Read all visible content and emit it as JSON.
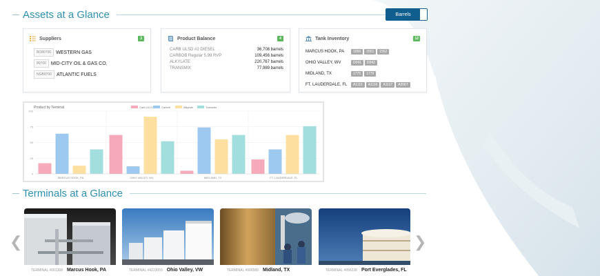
{
  "assets_section": {
    "title": "Assets at a Glance",
    "unit_toggle": "Barrels"
  },
  "suppliers": {
    "title": "Suppliers",
    "count": "3",
    "items": [
      {
        "code": "BO80700",
        "name": "WESTERN GAS"
      },
      {
        "code": "80700",
        "name": "MID-CITY OIL & GAS CO."
      },
      {
        "code": "NGB0700",
        "name": "ATLANTIC FUELS"
      }
    ]
  },
  "product_balance": {
    "title": "Product Balance",
    "count": "4",
    "items": [
      {
        "name": "CARB ULSD #2 DIESEL",
        "value": "36,708 barrels"
      },
      {
        "name": "CARBOB Regular 5.99 RVP",
        "value": "109,456 barrels"
      },
      {
        "name": "ALKYLATE",
        "value": "220,767 barrels"
      },
      {
        "name": "TRANSMIX",
        "value": "77,989 barrels"
      }
    ]
  },
  "tank_inventory": {
    "title": "Tank Inventory",
    "count": "12",
    "items": [
      {
        "location": "MARCUS HOOK, PA",
        "tanks": [
          "1056",
          "1551",
          "1552"
        ]
      },
      {
        "location": "OHIO VALLEY, WV",
        "tanks": [
          "D041",
          "D042"
        ]
      },
      {
        "location": "MIDLAND, TX",
        "tanks": [
          "1775",
          "1776"
        ]
      },
      {
        "location": "FT. LAUDERDALE, FL",
        "tanks": [
          "A1115",
          "A1116",
          "A1117",
          "A0567"
        ]
      }
    ]
  },
  "chart_data": {
    "type": "bar",
    "title": "Product by Terminal",
    "categories": [
      "MARCUS HOOK, PA",
      "OHIO VALLEY, WV",
      "MIDLAND, TX",
      "FT. LAUDERDALE, FL"
    ],
    "series": [
      {
        "name": "Carb ULLS",
        "color": "#f6a9b9",
        "values": [
          17,
          62,
          5,
          23
        ]
      },
      {
        "name": "Carbob",
        "color": "#9dc8ef",
        "values": [
          64,
          12,
          74,
          39
        ]
      },
      {
        "name": "Alkylate",
        "color": "#fde0a0",
        "values": [
          13,
          91,
          55,
          62
        ]
      },
      {
        "name": "Transmix",
        "color": "#a3dede",
        "values": [
          39,
          52,
          62,
          76
        ]
      }
    ],
    "ylim": [
      0,
      100
    ],
    "yticks": [
      "0",
      "25",
      "50",
      "75",
      "100"
    ],
    "grid": true,
    "legend": "top"
  },
  "terminals_section": {
    "title": "Terminals at a Glance",
    "prev": "❮",
    "next": "❯"
  },
  "terminals": [
    {
      "number": "TERMINAL #001368",
      "name": "Marcus Hook, PA"
    },
    {
      "number": "TERMINAL #4223059",
      "name": "Ohio Valley, VW"
    },
    {
      "number": "TERMINAL #006589",
      "name": "Midland, TX"
    },
    {
      "number": "TERMINAL #056238",
      "name": "Port Everglades, FL"
    }
  ],
  "colors": {
    "accent": "#2e8fb0",
    "toggle": "#0f5e8e",
    "badge": "#5cb85c"
  }
}
